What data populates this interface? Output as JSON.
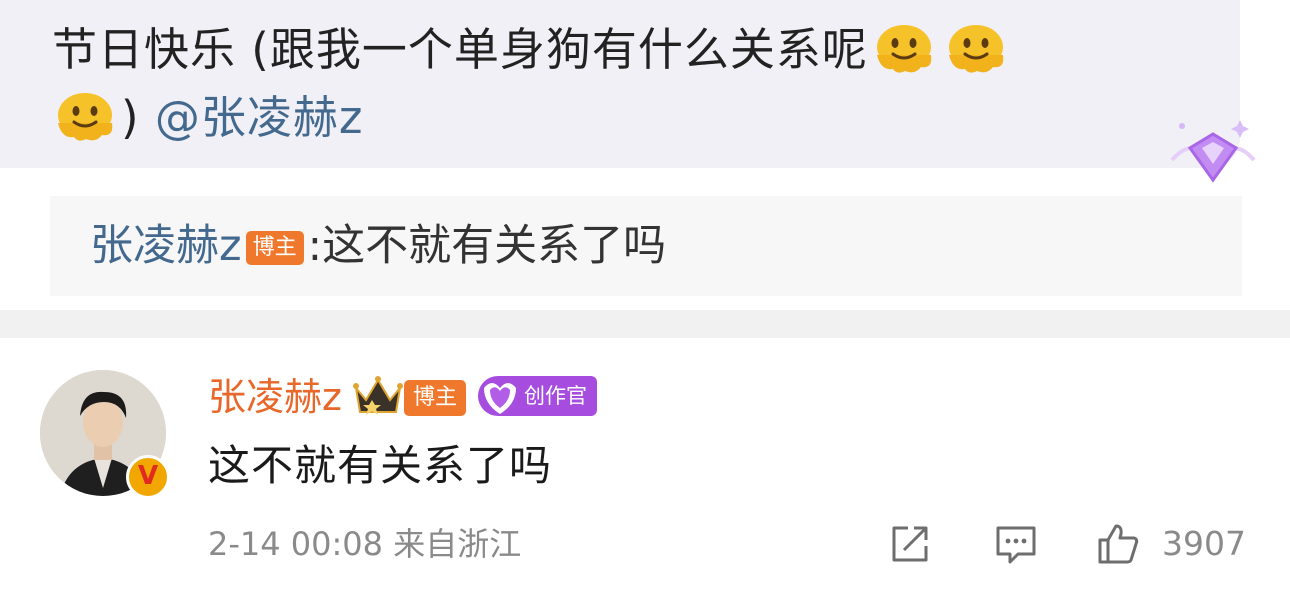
{
  "quoted_comment": {
    "text_part1": "节日快乐 (跟我一个单身狗有什么关系呢",
    "text_part2": ")",
    "emoji_name": "melting-face-emoji",
    "mention": "@张凌赫z",
    "badge_icon": "diamond-gem-icon",
    "reply": {
      "author": "张凌赫z",
      "author_badge": "博主",
      "separator": ":",
      "text": "这不就有关系了吗"
    }
  },
  "comment": {
    "author": "张凌赫z",
    "crown_icon": "crown-icon",
    "badge_bozhu": "博主",
    "badge_creator": "创作官",
    "verified_mark": "V",
    "text": "这不就有关系了吗",
    "timestamp": "2-14 00:08",
    "location": "来自浙江",
    "like_count": "3907"
  },
  "colors": {
    "mention_blue": "#44698e",
    "author_orange": "#e8672a",
    "badge_orange": "#f0782c",
    "creator_purple": "#a64de0",
    "meta_gray": "#8a8a8a"
  }
}
